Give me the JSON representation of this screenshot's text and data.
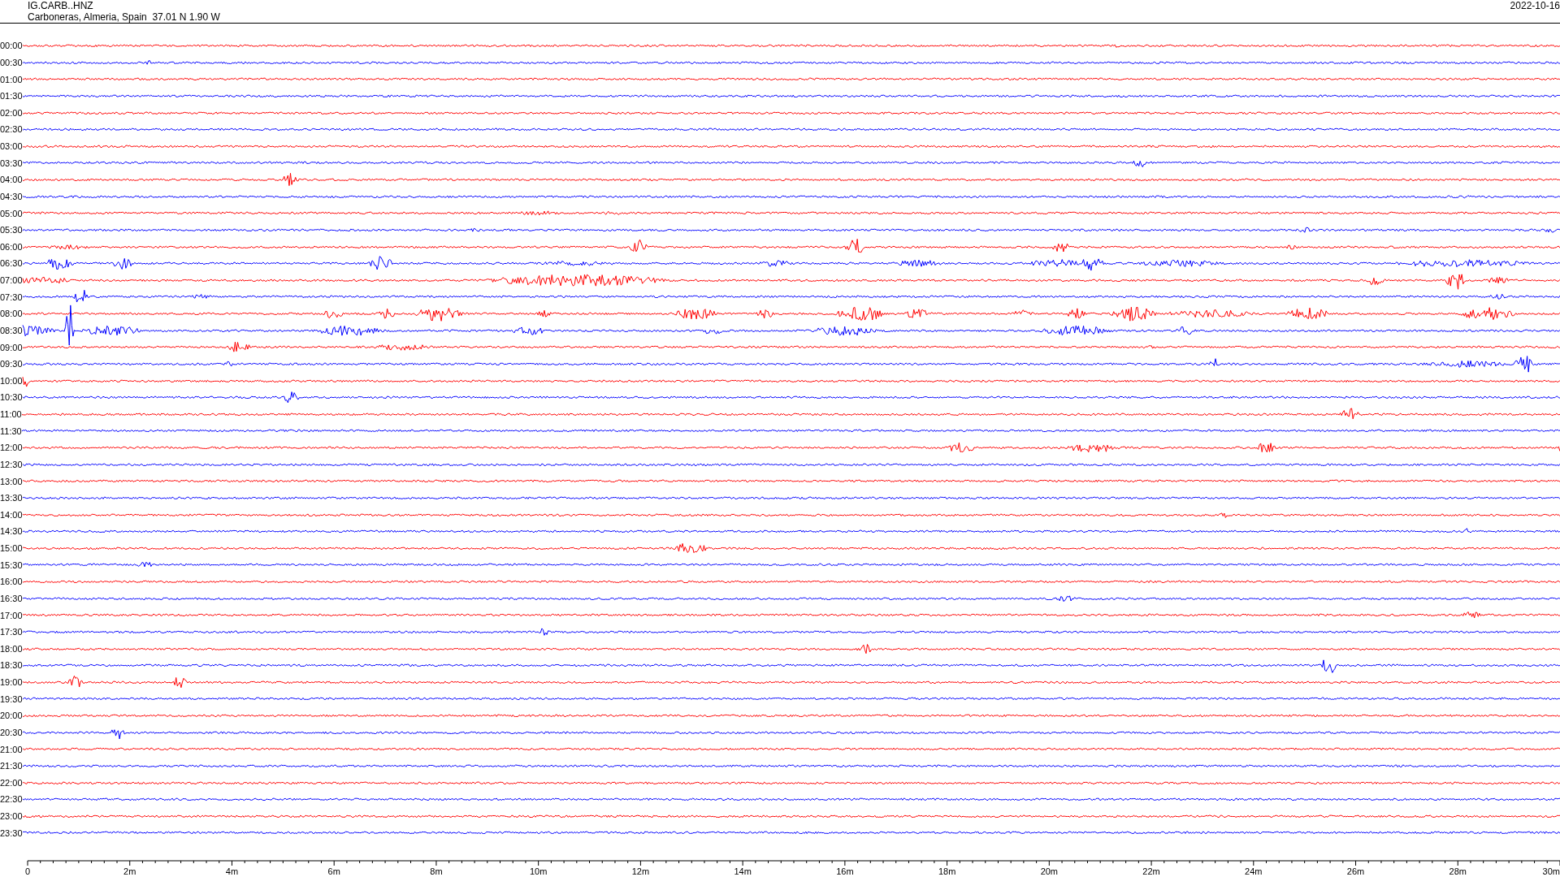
{
  "header": {
    "station": "IG.CARB..HNZ",
    "location": "Carboneras, Almeria, Spain  37.01 N 1.90 W",
    "date": "2022-10-16"
  },
  "traces": [
    {
      "label": "00:00",
      "color": "#ff0000"
    },
    {
      "label": "00:30",
      "color": "#0000ff"
    },
    {
      "label": "01:00",
      "color": "#ff0000"
    },
    {
      "label": "01:30",
      "color": "#0000ff"
    },
    {
      "label": "02:00",
      "color": "#ff0000"
    },
    {
      "label": "02:30",
      "color": "#0000ff"
    },
    {
      "label": "03:00",
      "color": "#ff0000"
    },
    {
      "label": "03:30",
      "color": "#0000ff"
    },
    {
      "label": "04:00",
      "color": "#ff0000"
    },
    {
      "label": "04:30",
      "color": "#0000ff"
    },
    {
      "label": "05:00",
      "color": "#ff0000"
    },
    {
      "label": "05:30",
      "color": "#0000ff"
    },
    {
      "label": "06:00",
      "color": "#ff0000"
    },
    {
      "label": "06:30",
      "color": "#0000ff"
    },
    {
      "label": "07:00",
      "color": "#ff0000"
    },
    {
      "label": "07:30",
      "color": "#0000ff"
    },
    {
      "label": "08:00",
      "color": "#ff0000"
    },
    {
      "label": "08:30",
      "color": "#0000ff"
    },
    {
      "label": "09:00",
      "color": "#ff0000"
    },
    {
      "label": "09:30",
      "color": "#0000ff"
    },
    {
      "label": "10:00",
      "color": "#ff0000"
    },
    {
      "label": "10:30",
      "color": "#0000ff"
    },
    {
      "label": "11:00",
      "color": "#ff0000"
    },
    {
      "label": "11:30",
      "color": "#0000ff"
    },
    {
      "label": "12:00",
      "color": "#ff0000"
    },
    {
      "label": "12:30",
      "color": "#0000ff"
    },
    {
      "label": "13:00",
      "color": "#ff0000"
    },
    {
      "label": "13:30",
      "color": "#0000ff"
    },
    {
      "label": "14:00",
      "color": "#ff0000"
    },
    {
      "label": "14:30",
      "color": "#0000ff"
    },
    {
      "label": "15:00",
      "color": "#ff0000"
    },
    {
      "label": "15:30",
      "color": "#0000ff"
    },
    {
      "label": "16:00",
      "color": "#ff0000"
    },
    {
      "label": "16:30",
      "color": "#0000ff"
    },
    {
      "label": "17:00",
      "color": "#ff0000"
    },
    {
      "label": "17:30",
      "color": "#0000ff"
    },
    {
      "label": "18:00",
      "color": "#ff0000"
    },
    {
      "label": "18:30",
      "color": "#0000ff"
    },
    {
      "label": "19:00",
      "color": "#ff0000"
    },
    {
      "label": "19:30",
      "color": "#0000ff"
    },
    {
      "label": "20:00",
      "color": "#ff0000"
    },
    {
      "label": "20:30",
      "color": "#0000ff"
    },
    {
      "label": "21:00",
      "color": "#ff0000"
    },
    {
      "label": "21:30",
      "color": "#0000ff"
    },
    {
      "label": "22:00",
      "color": "#ff0000"
    },
    {
      "label": "22:30",
      "color": "#0000ff"
    },
    {
      "label": "23:00",
      "color": "#ff0000"
    },
    {
      "label": "23:30",
      "color": "#0000ff"
    }
  ],
  "time_axis": {
    "labels": [
      "0",
      "2m",
      "4m",
      "6m",
      "8m",
      "10m",
      "12m",
      "14m",
      "16m",
      "18m",
      "20m",
      "22m",
      "24m",
      "26m",
      "28m",
      "30m"
    ]
  }
}
